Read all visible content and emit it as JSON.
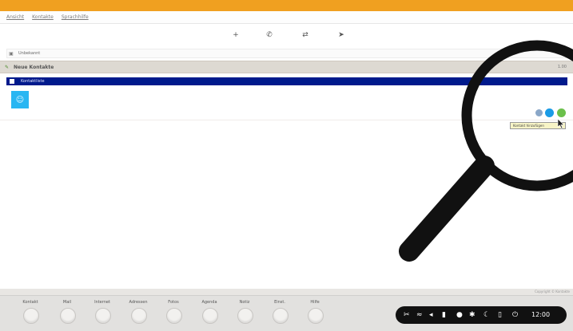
{
  "menu": {
    "items": [
      "Ansicht",
      "Kontakte",
      "Sprachhilfe"
    ]
  },
  "toolbar": {
    "tools": [
      {
        "name": "add-contact",
        "glyph": "+"
      },
      {
        "name": "call",
        "glyph": "✆"
      },
      {
        "name": "transfer",
        "glyph": "⇄"
      },
      {
        "name": "pointer",
        "glyph": "➤"
      }
    ]
  },
  "address": {
    "icon": "user-icon",
    "value": "Unbekannt"
  },
  "header": {
    "title": "Neue Kontakte",
    "right": "1.00"
  },
  "selected_row": {
    "label": "Kontaktliste"
  },
  "actions": {
    "colors": [
      "#8aa7c8",
      "#1a9be6",
      "#6bc04b"
    ]
  },
  "tooltip": {
    "text": "Kontakt hinzufügen"
  },
  "footer": {
    "right": "Copyright © Kontakte"
  },
  "nav": {
    "items": [
      {
        "label": "Kontakt"
      },
      {
        "label": "Mail"
      },
      {
        "label": "Internet"
      },
      {
        "label": "Adressen"
      },
      {
        "label": "Fotos"
      },
      {
        "label": "Agenda"
      },
      {
        "label": "Notiz"
      },
      {
        "label": "Einst."
      },
      {
        "label": "Hilfe"
      }
    ]
  },
  "tray": {
    "time": "12:00"
  }
}
